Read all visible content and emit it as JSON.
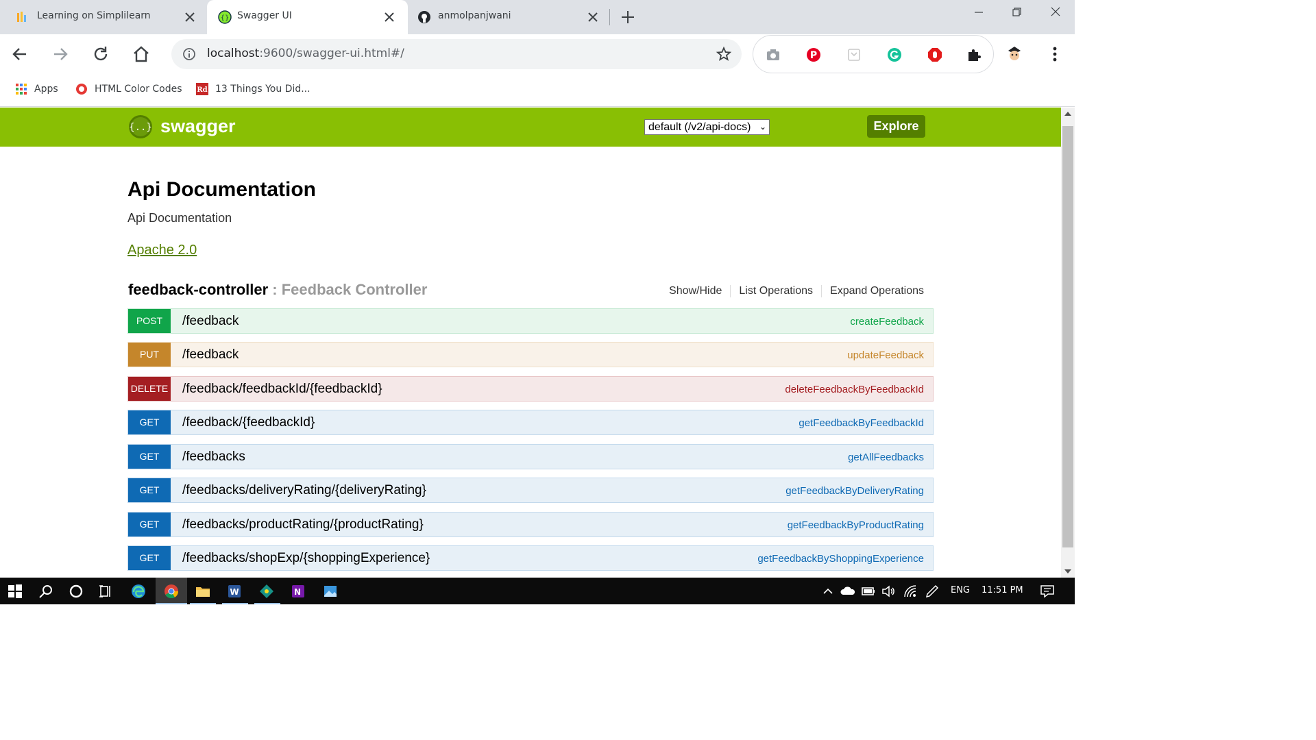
{
  "browser": {
    "tabs": [
      {
        "title": "Learning on Simplilearn",
        "active": false,
        "icon": "simplilearn-icon"
      },
      {
        "title": "Swagger UI",
        "active": true,
        "icon": "swagger-icon"
      },
      {
        "title": "anmolpanjwani",
        "active": false,
        "icon": "github-icon"
      }
    ],
    "url_host": "localhost",
    "url_rest": ":9600/swagger-ui.html#/",
    "bookmarks": [
      {
        "label": "Apps",
        "icon": "apps-grid-icon"
      },
      {
        "label": "HTML Color Codes",
        "icon": "html-color-codes-icon"
      },
      {
        "label": "13 Things You Did...",
        "icon": "rd-icon"
      }
    ],
    "extensions": [
      "camera-icon",
      "pinterest-icon",
      "pocket-icon",
      "grammarly-icon",
      "adblock-icon",
      "puzzle-icon"
    ]
  },
  "swagger": {
    "brand": "swagger",
    "spec_select": "default (/v2/api-docs)",
    "explore_label": "Explore",
    "colors": {
      "header": "#89bf04",
      "explore": "#547f00",
      "post": "#10a54a",
      "put": "#c5862b",
      "delete": "#a41e22",
      "get": "#0f6ab4"
    }
  },
  "info": {
    "title": "Api Documentation",
    "description": "Api Documentation",
    "license": "Apache 2.0"
  },
  "controller": {
    "name": "feedback-controller",
    "separator": " : ",
    "description": "Feedback Controller",
    "links": [
      "Show/Hide",
      "List Operations",
      "Expand Operations"
    ]
  },
  "operations": [
    {
      "method": "POST",
      "path": "/feedback",
      "nickname": "createFeedback"
    },
    {
      "method": "PUT",
      "path": "/feedback",
      "nickname": "updateFeedback"
    },
    {
      "method": "DELETE",
      "path": "/feedback/feedbackId/{feedbackId}",
      "nickname": "deleteFeedbackByFeedbackId"
    },
    {
      "method": "GET",
      "path": "/feedback/{feedbackId}",
      "nickname": "getFeedbackByFeedbackId"
    },
    {
      "method": "GET",
      "path": "/feedbacks",
      "nickname": "getAllFeedbacks"
    },
    {
      "method": "GET",
      "path": "/feedbacks/deliveryRating/{deliveryRating}",
      "nickname": "getFeedbackByDeliveryRating"
    },
    {
      "method": "GET",
      "path": "/feedbacks/productRating/{productRating}",
      "nickname": "getFeedbackByProductRating"
    },
    {
      "method": "GET",
      "path": "/feedbacks/shopExp/{shoppingExperience}",
      "nickname": "getFeedbackByShoppingExperience"
    }
  ],
  "taskbar": {
    "language": "ENG",
    "time": "11:51 PM"
  }
}
